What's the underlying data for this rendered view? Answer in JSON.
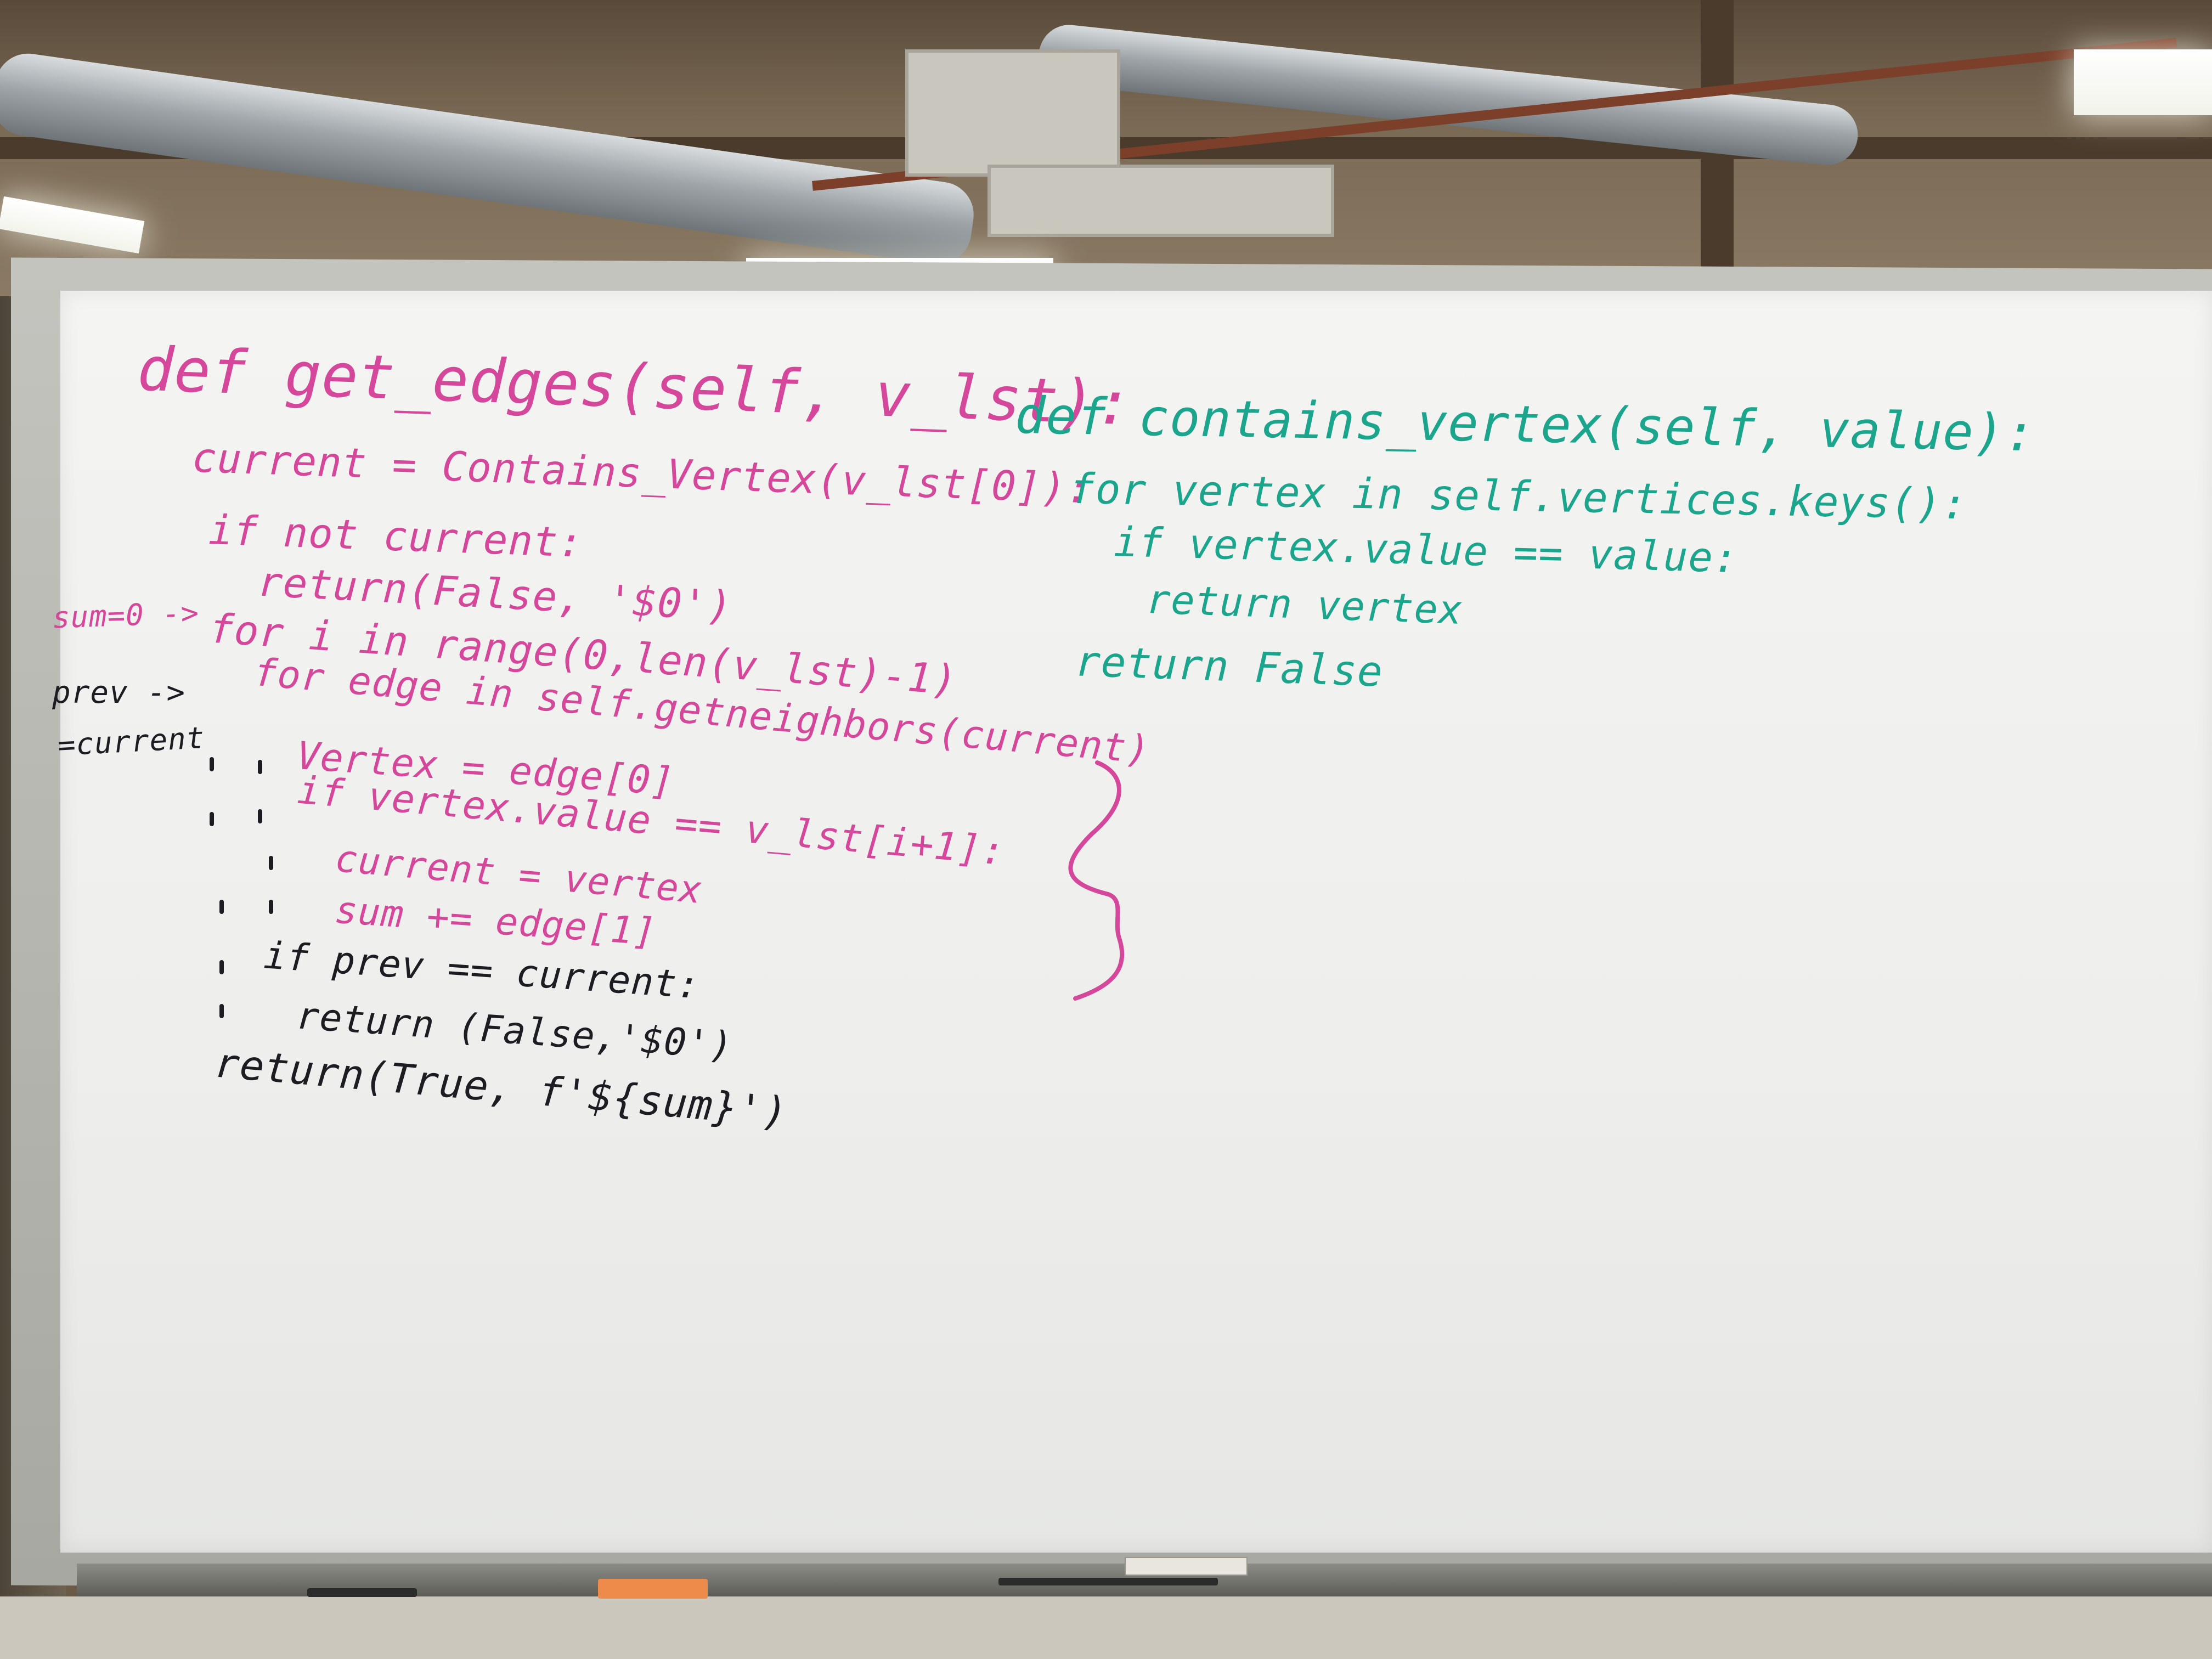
{
  "whiteboard": {
    "left_function": {
      "signature": "def get_edges(self, v_lst):",
      "lines_pink": [
        "current = Contains_Vertex(v_lst[0]):",
        "if not current:",
        "return(False, '$0')",
        "for i in range(0,len(v_lst)-1)",
        "for edge in self.getneighbors(current)",
        "Vertex = edge[0]",
        "if vertex.value == v_lst[i+1]:",
        "current = vertex",
        "sum += edge[1]"
      ],
      "lines_black": [
        "if prev == current:",
        "return (False,'$0')",
        "return(True, f'${sum}')"
      ],
      "margin_notes": {
        "sum_note": "sum=0 ->",
        "prev_note": "prev ->",
        "current_note": "=current"
      }
    },
    "right_function": {
      "signature": "def contains_vertex(self, value):",
      "lines": [
        "for vertex in self.vertices.keys():",
        "if vertex.value == value:",
        "return vertex",
        "return False"
      ]
    },
    "colors": {
      "pink_marker": "#d4479a",
      "teal_marker": "#1ba58d",
      "black_marker": "#1c1c22"
    }
  }
}
